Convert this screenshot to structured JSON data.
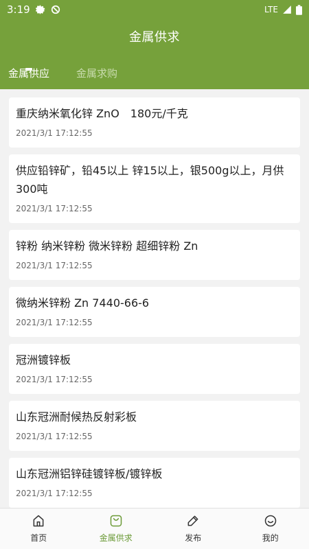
{
  "status_bar": {
    "time": "3:19",
    "network": "LTE"
  },
  "header": {
    "title": "金属供求"
  },
  "tabs": [
    {
      "label": "金属供应",
      "active": true
    },
    {
      "label": "金属求购",
      "active": false
    }
  ],
  "listings": [
    {
      "title": "重庆纳米氧化锌 ZnO　180元/千克",
      "date": "2021/3/1 17:12:55"
    },
    {
      "title": "供应铅锌矿，铅45以上 锌15以上，银500g以上，月供300吨",
      "date": "2021/3/1 17:12:55"
    },
    {
      "title": "锌粉 纳米锌粉 微米锌粉 超细锌粉 Zn",
      "date": "2021/3/1 17:12:55"
    },
    {
      "title": "微纳米锌粉 Zn 7440-66-6",
      "date": "2021/3/1 17:12:55"
    },
    {
      "title": "冠洲镀锌板",
      "date": "2021/3/1 17:12:55"
    },
    {
      "title": "山东冠洲耐候热反射彩板",
      "date": "2021/3/1 17:12:55"
    },
    {
      "title": "山东冠洲铝锌硅镀锌板/镀锌板",
      "date": "2021/3/1 17:12:55"
    }
  ],
  "bottom_nav": [
    {
      "label": "首页",
      "icon": "home-icon",
      "active": false
    },
    {
      "label": "金属供求",
      "icon": "bag-icon",
      "active": true
    },
    {
      "label": "发布",
      "icon": "pencil-icon",
      "active": false
    },
    {
      "label": "我的",
      "icon": "smiley-icon",
      "active": false
    }
  ],
  "colors": {
    "brand": "#76a13b",
    "active_nav": "#6b9a37"
  }
}
